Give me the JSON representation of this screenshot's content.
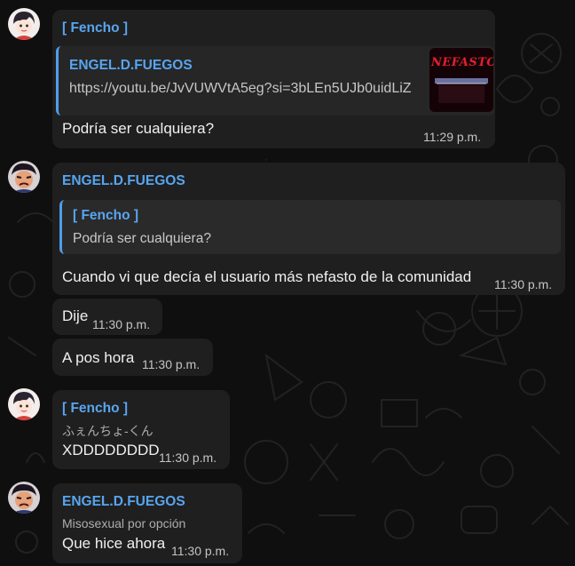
{
  "messages": [
    {
      "sender": "[ Fencho ]",
      "link_preview": {
        "title": "ENGEL.D.FUEGOS",
        "url": "https://youtu.be/JvVUWVtA5eg?si=3bLEn5UJb0uidLiZ",
        "thumbnail_text": "Nefasto"
      },
      "text": "Podría ser cualquiera?",
      "time": "11:29 p.m."
    },
    {
      "sender": "ENGEL.D.FUEGOS",
      "reply_to": {
        "name": "[ Fencho ]",
        "text": "Podría ser cualquiera?"
      },
      "text": "Cuando vi que decía el usuario más nefasto de la comunidad",
      "time": "11:30 p.m."
    },
    {
      "text": "Dije",
      "time": "11:30 p.m."
    },
    {
      "text": "A pos hora",
      "time": "11:30 p.m."
    },
    {
      "sender": "[ Fencho ]",
      "subtitle": "ふぇんちょ-くん",
      "text": "XDDDDDDDD",
      "time": "11:30 p.m."
    },
    {
      "sender": "ENGEL.D.FUEGOS",
      "subtitle": "Misosexual por opción",
      "text": "Que hice ahora",
      "time": "11:30 p.m."
    }
  ],
  "colors": {
    "background": "#0f0f0f",
    "bubble": "#1f1f1f",
    "accent": "#58a5f0"
  },
  "icons": [
    "avatar-fencho",
    "avatar-engel"
  ]
}
